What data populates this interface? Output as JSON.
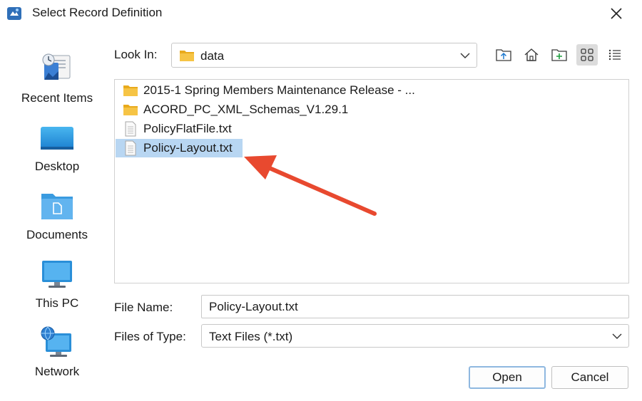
{
  "window": {
    "title": "Select Record Definition",
    "icon": "app-icon",
    "close_icon": "close-icon"
  },
  "places": [
    {
      "label": "Recent Items",
      "icon": "recent-items-icon"
    },
    {
      "label": "Desktop",
      "icon": "desktop-icon"
    },
    {
      "label": "Documents",
      "icon": "documents-icon"
    },
    {
      "label": "This PC",
      "icon": "this-pc-icon"
    },
    {
      "label": "Network",
      "icon": "network-icon"
    }
  ],
  "lookin": {
    "label": "Look In:",
    "value": "data",
    "icon": "folder-icon"
  },
  "toolbar": [
    {
      "name": "up-one-level-button",
      "icon": "folder-up-icon"
    },
    {
      "name": "home-button",
      "icon": "home-icon"
    },
    {
      "name": "new-folder-button",
      "icon": "new-folder-icon"
    },
    {
      "name": "list-view-button",
      "icon": "grid-view-icon",
      "active": true
    },
    {
      "name": "details-view-button",
      "icon": "details-view-icon"
    }
  ],
  "files": [
    {
      "name": "2015-1 Spring Members Maintenance Release - ...",
      "type": "folder"
    },
    {
      "name": "ACORD_PC_XML_Schemas_V1.29.1",
      "type": "folder"
    },
    {
      "name": "PolicyFlatFile.txt",
      "type": "file"
    },
    {
      "name": "Policy-Layout.txt",
      "type": "file",
      "selected": true
    }
  ],
  "file_name": {
    "label": "File Name:",
    "value": "Policy-Layout.txt"
  },
  "file_type": {
    "label": "Files of Type:",
    "value": "Text Files (*.txt)"
  },
  "buttons": {
    "open": "Open",
    "cancel": "Cancel"
  },
  "colors": {
    "selection": "#b8d6f2",
    "folder": "#f6c445",
    "annotation_arrow": "#e8492f"
  }
}
